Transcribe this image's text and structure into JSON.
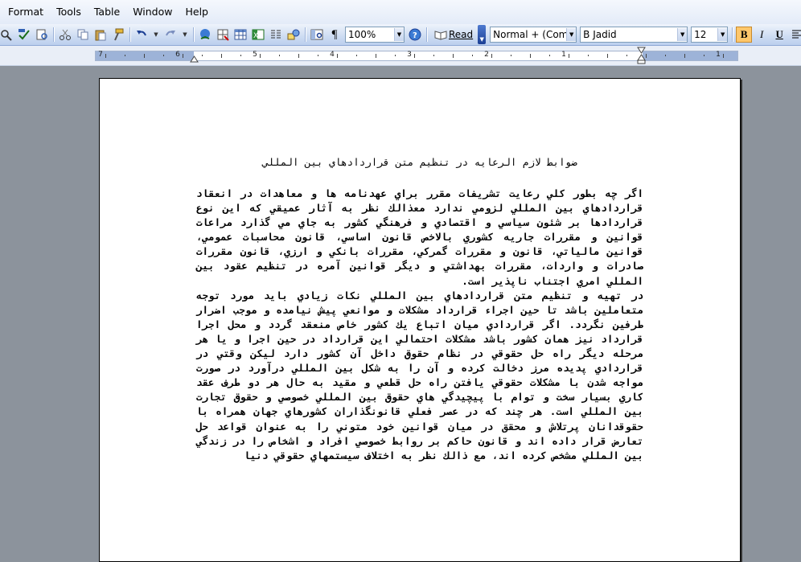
{
  "menu": [
    "Format",
    "Tools",
    "Table",
    "Window",
    "Help"
  ],
  "toolbar": {
    "zoom": "100%",
    "read_label": "Read",
    "style": "Normal + (Comp",
    "font": "B Jadid",
    "size": "12",
    "bold": "B",
    "italic": "I",
    "underline": "U"
  },
  "ruler": {
    "numbers": [
      "7",
      "6",
      "5",
      "4",
      "3",
      "2",
      "1",
      "1"
    ]
  },
  "document": {
    "title": "ضوابط لازم الرعايه در تنظيم متن قراردادهاي بين المللي",
    "paragraphs": [
      "اگر چه بطور كلي رعايت تشريفات مقرر براي عهدنامه ها و معاهدات در انعقاد قراردادهاي بين المللي لزومي ندارد معذالك نظر به آثار عميقي كه اين نوع قراردادها بر شئون سياسي و اقتصادي و فرهنگي كشور به جاي مي گذارد مراعات قوانين و مقررات جاريه كشوري بالاخص قانون اساسي، قانون محاسبات عمومي، قوانين مالياتي، قانون و مقررات گمركي، مقررات بانكي و ارزي، قانون مقررات صادرات و واردات، مقررات بهداشتي و ديگر قوانين آمره در تنظيم عقود بين المللي امري اجتناب ناپذير است.",
      "در تهيه و تنظيم متن قراردادهاي بين المللي نكات زيادي بايد مورد توجه متعاملين باشد تا حين اجراء قرارداد مشكلات و موانعي پيش نيامده و موجب اضرار طرفين نگردد. اگر قراردادي ميان اتباع يك كشور خاص منعقد گردد و محل اجرا قرارداد نيز همان كشور باشد مشكلات احتمالي اين قرارداد در حين اجرا و يا هر مرحله ديگر راه حل حقوقي در نظام حقوق داخل آن كشور دارد ليكن وقتي در قراردادي پديده مرز دخالت كرده و آن را به شكل بين المللي درآورد در صورت مواجه شدن با مشكلات حقوقي يافتن راه حل قطعي و مقيد به حال هر دو طرف عقد كاري بسيار سخت و توام با پيچيدگي هاي حقوق بين المللي خصوصي و حقوق تجارت بين المللي است. هر چند كه در عصر فعلي قانونگذاران كشورهاي جهان همراه با حقوقدانان پرتلاش و محقق در ميان قوانين خود متوني را به عنوان قواعد حل تعارض قرار داده اند و قانون حاكم بر روابط خصوصي افراد و اشخاص را در زندگي بين المللي مشخص كرده اند، مع ذالك نظر به اختلاف سيستمهاي حقوقي دنيا"
    ]
  },
  "colors": {
    "menubar": "#e3ebf8",
    "toolbar": "#cddcf2",
    "workspace": "#8c939c",
    "active_button": "#ffc76b"
  }
}
